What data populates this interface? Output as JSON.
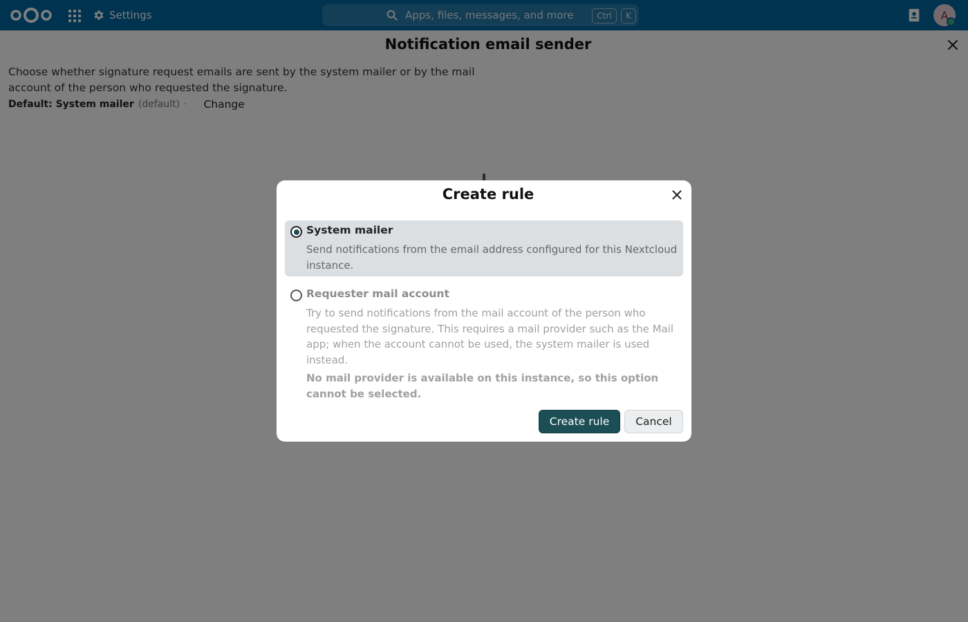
{
  "header": {
    "settings_label": "Settings",
    "search_placeholder": "Apps, files, messages, and more",
    "shortcut_ctrl": "Ctrl",
    "shortcut_key": "K",
    "avatar_initial": "A"
  },
  "page": {
    "title": "Notification email sender",
    "description": "Choose whether signature request emails are sent by the system mailer or by the mail account of the person who requested the signature.",
    "default_label": "Default: System mailer",
    "default_suffix": "(default)",
    "separator": "·",
    "change_label": "Change"
  },
  "modal": {
    "title": "Create rule",
    "options": [
      {
        "label": "System mailer",
        "description": "Send notifications from the email address configured for this Nextcloud instance.",
        "selected": true,
        "disabled": false
      },
      {
        "label": "Requester mail account",
        "description": "Try to send notifications from the mail account of the person who requested the signature. This requires a mail provider such as the Mail app; when the account cannot be used, the system mailer is used instead.",
        "note": "No mail provider is available on this instance, so this option cannot be selected.",
        "selected": false,
        "disabled": true
      }
    ],
    "create_label": "Create rule",
    "cancel_label": "Cancel"
  },
  "colors": {
    "header_bg": "#00679e",
    "primary_button": "#1b4f55",
    "selected_option_bg": "#dbdfe2"
  }
}
